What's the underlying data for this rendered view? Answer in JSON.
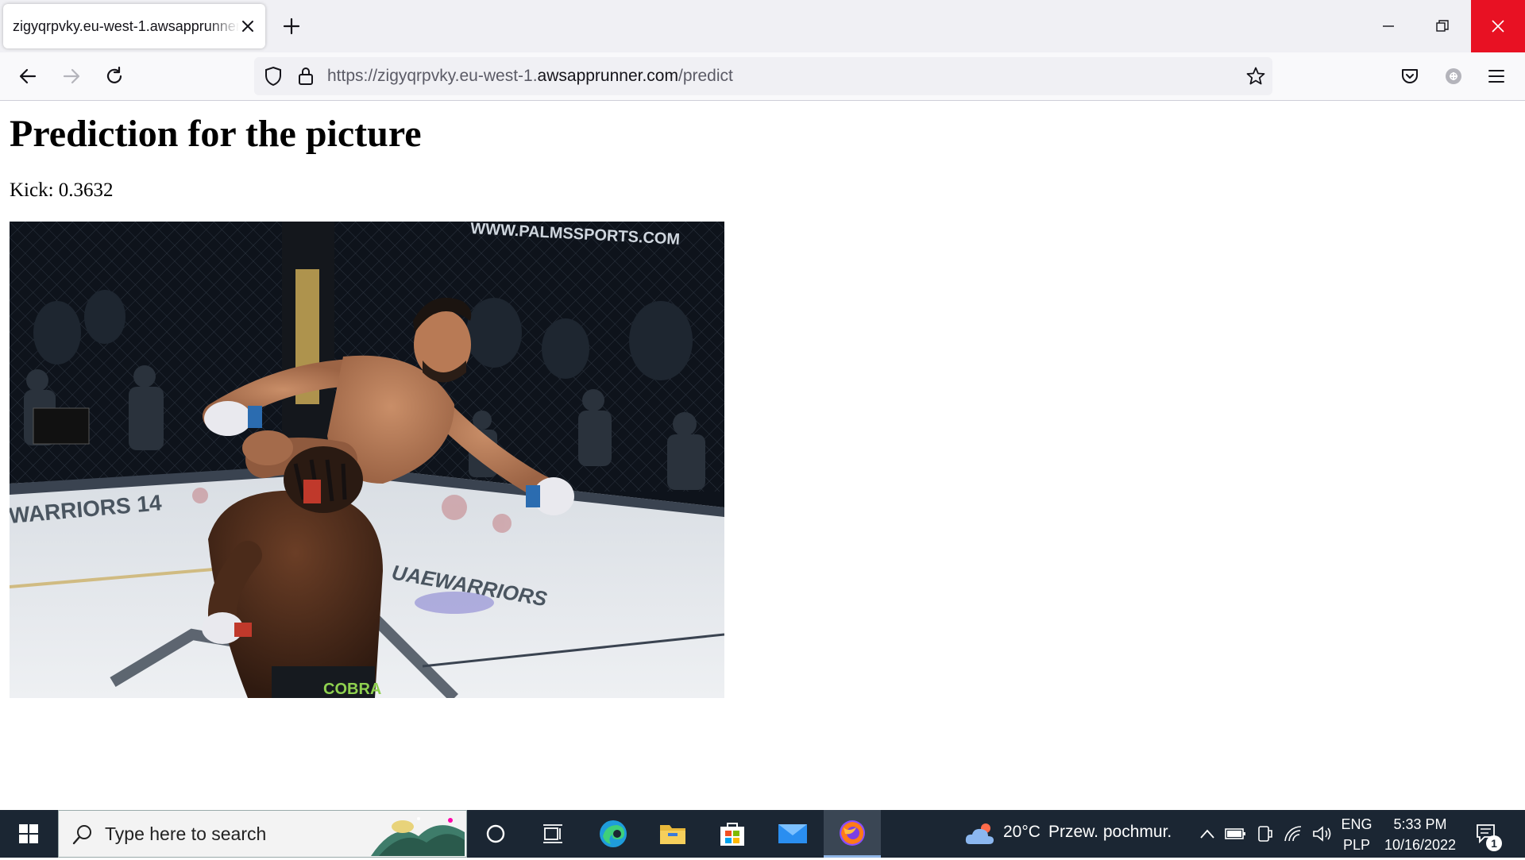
{
  "browser": {
    "tab_title": "zigyqrpvky.eu-west-1.awsapprunner.com/predict",
    "url_prefix": "https://zigyqrpvky.eu-west-1.",
    "url_domain": "awsapprunner.com",
    "url_path": "/predict"
  },
  "page": {
    "heading": "Prediction for the picture",
    "prediction": "Kick: 0.3632",
    "image_description_icon": "mma-fight-photo"
  },
  "taskbar": {
    "search_placeholder": "Type here to search",
    "weather_temp": "20°C",
    "weather_desc": "Przew. pochmur.",
    "lang_top": "ENG",
    "lang_bottom": "PLP",
    "time": "5:33 PM",
    "date": "10/16/2022",
    "notification_count": "1"
  },
  "colors": {
    "tab_strip": "#f0f0f4",
    "close_red": "#e81123",
    "taskbar": "#1b2633"
  }
}
